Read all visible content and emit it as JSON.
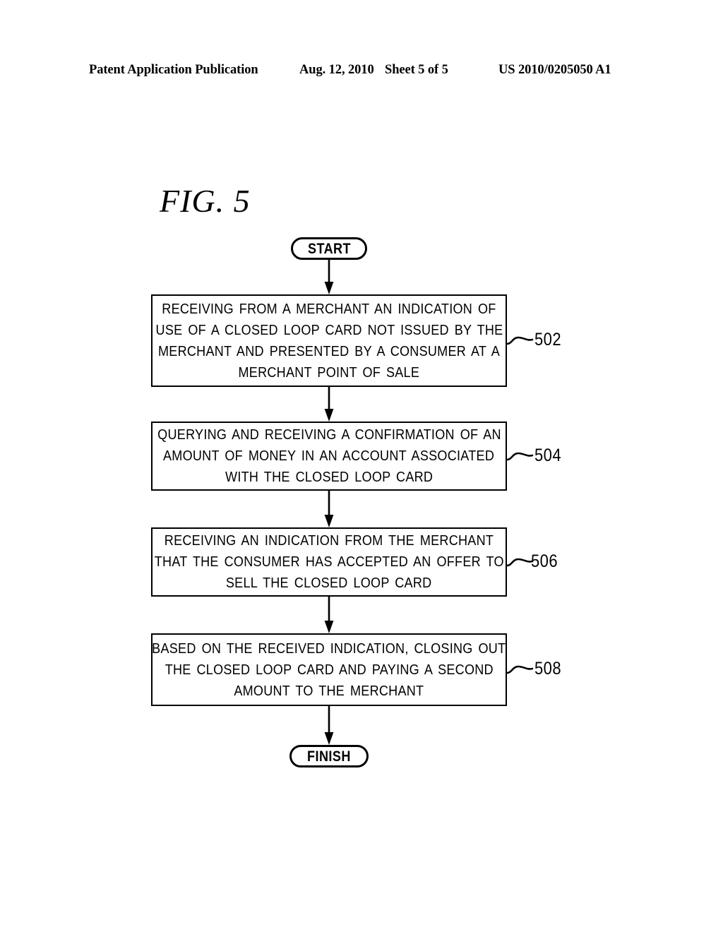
{
  "header": {
    "publication": "Patent Application Publication",
    "date": "Aug. 12, 2010",
    "sheet": "Sheet 5 of 5",
    "document_number": "US 2010/0205050 A1"
  },
  "figure": {
    "label": "FIG. 5",
    "type": "flowchart",
    "ink_color": "#000000",
    "background_color": "#ffffff"
  },
  "flowchart": {
    "start": {
      "label": "START"
    },
    "finish": {
      "label": "FINISH"
    },
    "steps": [
      {
        "ref": "502",
        "lines": [
          "RECEIVING FROM A MERCHANT AN INDICATION OF",
          "USE OF A CLOSED LOOP CARD NOT ISSUED BY THE",
          "MERCHANT AND PRESENTED BY A CONSUMER AT A",
          "MERCHANT POINT OF SALE"
        ]
      },
      {
        "ref": "504",
        "lines": [
          "QUERYING AND RECEIVING A CONFIRMATION OF AN",
          "AMOUNT OF MONEY IN AN ACCOUNT ASSOCIATED",
          "WITH THE CLOSED LOOP CARD"
        ]
      },
      {
        "ref": "506",
        "lines": [
          "RECEIVING AN INDICATION FROM THE MERCHANT",
          "THAT THE CONSUMER HAS ACCEPTED AN OFFER TO",
          "SELL THE CLOSED LOOP CARD"
        ]
      },
      {
        "ref": "508",
        "lines": [
          "BASED ON THE RECEIVED INDICATION, CLOSING OUT",
          "THE CLOSED LOOP CARD AND PAYING A SECOND",
          "AMOUNT TO THE MERCHANT"
        ]
      }
    ]
  }
}
